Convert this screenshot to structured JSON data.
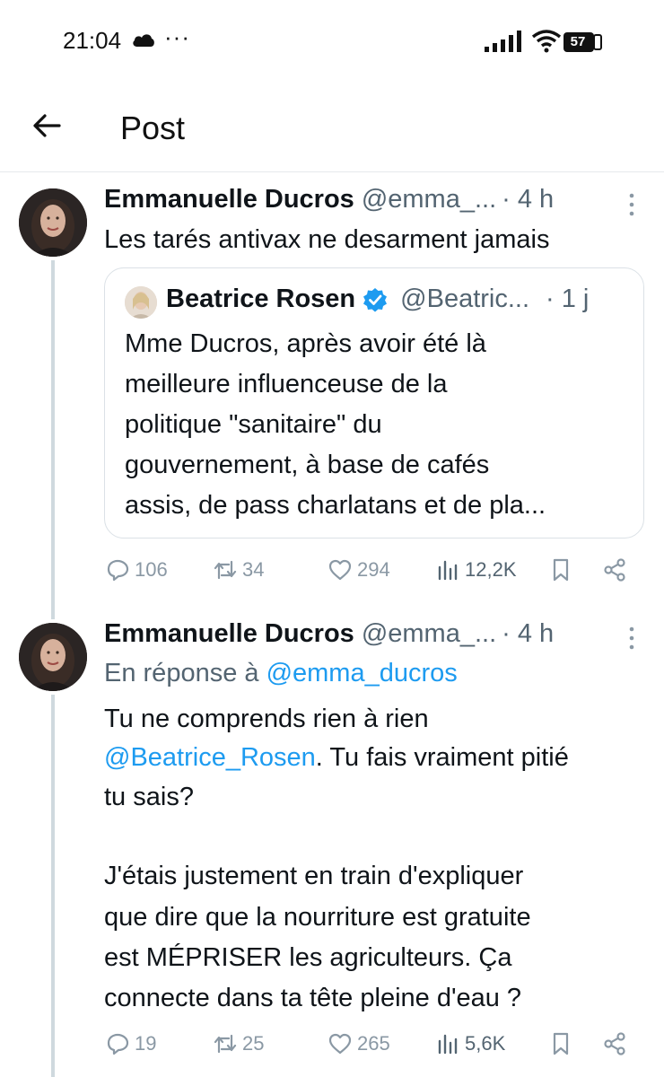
{
  "status_bar": {
    "time": "21:04",
    "dots": "···",
    "battery": "57",
    "icons": [
      "cloud-icon",
      "signal-icon",
      "wifi-icon",
      "battery-icon"
    ]
  },
  "header": {
    "title": "Post",
    "back_icon": "arrow-left-icon"
  },
  "colors": {
    "link": "#1d9bf0",
    "secondary_text": "#536471",
    "verified": "#1d9bf0",
    "divider": "#e6e9ec"
  },
  "tweet1": {
    "name": "Emmanuelle Ducros",
    "handle": "@emma_...",
    "time": "· 4 h",
    "text": "Les tarés antivax ne desarment jamais",
    "quote": {
      "name": "Beatrice Rosen",
      "handle": "@Beatric...",
      "time": "· 1 j",
      "lines": [
        "Mme Ducros, après avoir été là",
        "meilleure influenceuse de la",
        "politique \"sanitaire\" du",
        "gouvernement, à base de cafés",
        "assis, de pass charlatans et de pla..."
      ]
    },
    "stats": {
      "replies": "106",
      "retweets": "34",
      "likes": "294",
      "views": "12,2K"
    }
  },
  "tweet2": {
    "name": "Emmanuelle Ducros",
    "handle": "@emma_...",
    "time": "· 4 h",
    "reply_prefix": "En réponse à ",
    "reply_to": "@emma_ducros",
    "line1": "Tu ne comprends rien à rien",
    "mention": "@Beatrice_Rosen",
    "line2_rest": ". Tu fais vraiment pitié",
    "line3": "tu sais?",
    "para2": [
      "J'étais justement en train d'expliquer",
      "que dire que la nourriture est gratuite",
      "est MÉPRISER les agriculteurs. Ça",
      "connecte dans ta tête pleine d'eau ?"
    ],
    "stats": {
      "replies": "19",
      "retweets": "25",
      "likes": "265",
      "views": "5,6K"
    }
  }
}
